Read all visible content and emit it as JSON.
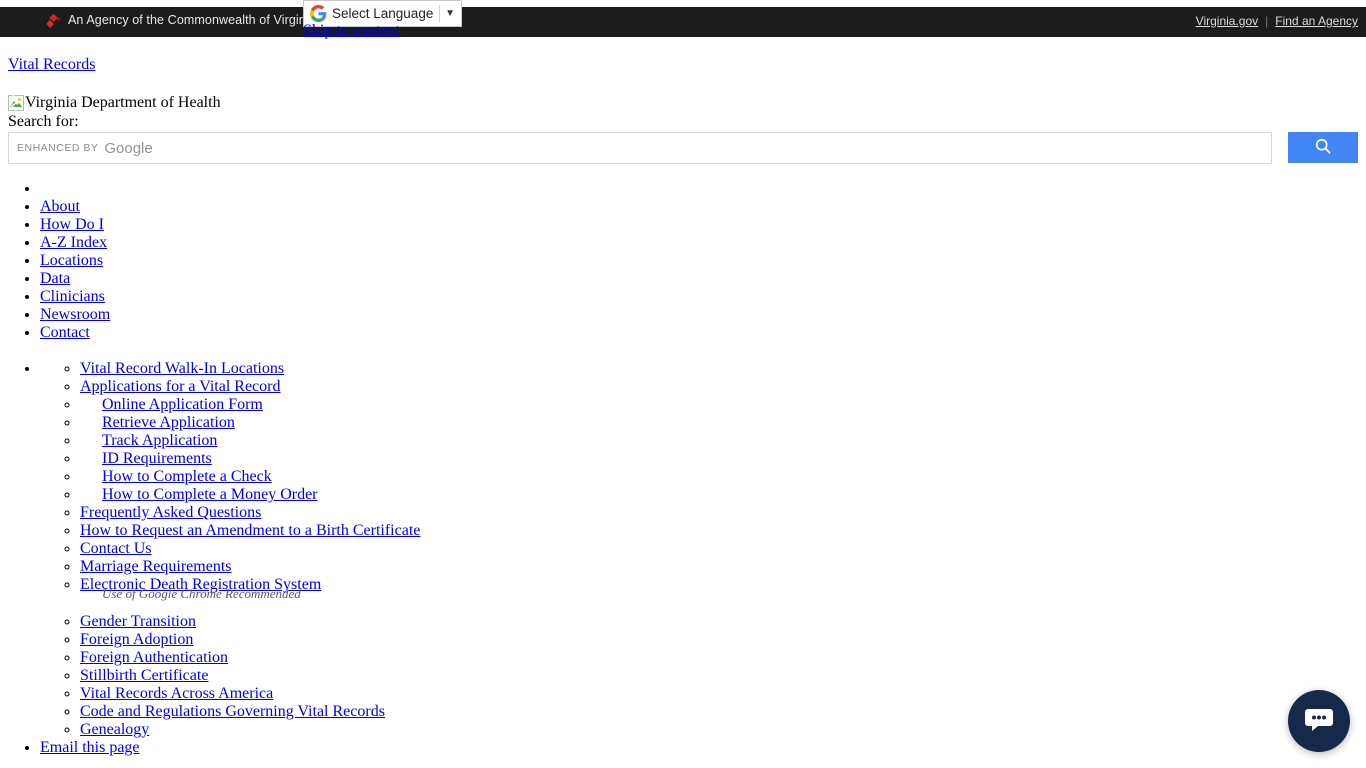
{
  "gov_bar": {
    "logo_icon": "virginia-agency-diamond-icon",
    "agency_text": "An Agency of the Commonwealth of Virginia",
    "links": [
      {
        "label": "Virginia.gov"
      },
      {
        "label": "Find an Agency"
      }
    ],
    "separator": "|"
  },
  "translate_widget": {
    "icon": "google-g-icon",
    "label": "Select Language",
    "caret": "▼"
  },
  "skip_link": {
    "label": "Skip to content"
  },
  "site": {
    "title_link": "Vital Records",
    "logo_alt": "Virginia Department of Health",
    "broken_image_icon": "broken-image-icon"
  },
  "search": {
    "label": "Search for:",
    "placeholder_enhanced": "ENHANCED BY",
    "placeholder_brand": "Google",
    "value": "",
    "button_icon": "search-icon",
    "button_color": "#4285f4"
  },
  "nav": {
    "items": [
      {
        "label": ""
      },
      {
        "label": "About"
      },
      {
        "label": "How Do I"
      },
      {
        "label": "A-Z Index"
      },
      {
        "label": "Locations"
      },
      {
        "label": "Data"
      },
      {
        "label": "Clinicians"
      },
      {
        "label": "Newsroom"
      },
      {
        "label": "Contact"
      }
    ]
  },
  "sub_nav": {
    "items": [
      {
        "label": "Vital Record Walk-In Locations",
        "indent": false
      },
      {
        "label": "Applications for a Vital Record",
        "indent": false
      },
      {
        "label": "Online Application Form",
        "indent": true
      },
      {
        "label": "Retrieve Application",
        "indent": true
      },
      {
        "label": "Track Application",
        "indent": true
      },
      {
        "label": "ID Requirements",
        "indent": true
      },
      {
        "label": "How to Complete a Check",
        "indent": true
      },
      {
        "label": "How to Complete a Money Order",
        "indent": true
      },
      {
        "label": "Frequently Asked Questions",
        "indent": false
      },
      {
        "label": "How to Request an Amendment to a Birth Certificate",
        "indent": false
      },
      {
        "label": "Contact Us",
        "indent": false
      },
      {
        "label": "Marriage Requirements",
        "indent": false
      }
    ],
    "edrs": {
      "label": "Electronic Death Registration System",
      "note": "Use of Google Chrome Recommended"
    },
    "items_after": [
      {
        "label": "Gender Transition"
      },
      {
        "label": "Foreign Adoption"
      },
      {
        "label": "Foreign Authentication"
      },
      {
        "label": "Stillbirth Certificate"
      },
      {
        "label": "Vital Records Across America"
      },
      {
        "label": "Code and Regulations Governing Vital Records"
      },
      {
        "label": "Genealogy"
      }
    ],
    "email_page": "Email this page"
  },
  "chat": {
    "icon": "chat-bubble-icon",
    "color": "#15294b"
  },
  "colors": {
    "link": "#0000ee",
    "gov_bar_bg": "#1c1c1c",
    "accent_blue": "#4285f4",
    "chat_navy": "#15294b"
  }
}
